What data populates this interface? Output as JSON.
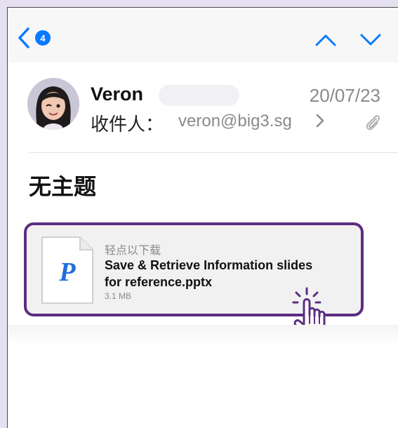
{
  "nav": {
    "unread_count": "4"
  },
  "message": {
    "sender": "Veron",
    "date": "20/07/23",
    "to_label": "收件人：",
    "to_address": "veron@big3.sg",
    "subject": "无主题"
  },
  "attachment": {
    "hint": "轻点以下载",
    "filename_line1": "Save & Retrieve Information slides",
    "filename_line2": "for reference.pptx",
    "size": "3.1 MB",
    "file_letter": "P"
  },
  "colors": {
    "accent": "#0a7aff",
    "highlight_border": "#5c2d82",
    "page_background": "#e6e1f1"
  }
}
